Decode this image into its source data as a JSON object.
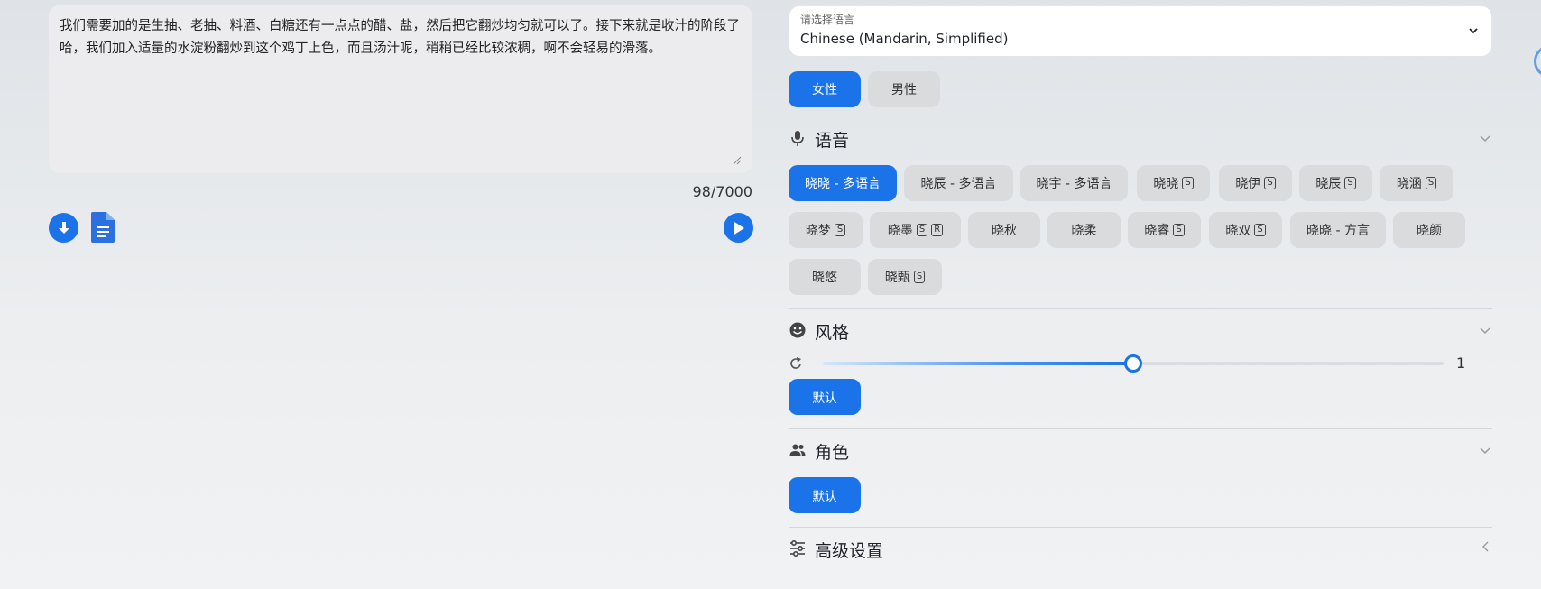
{
  "editor": {
    "text": "我们需要加的是生抽、老抽、料酒、白糖还有一点点的醋、盐，然后把它翻炒均匀就可以了。接下来就是收汁的阶段了哈，我们加入适量的水淀粉翻炒到这个鸡丁上色，而且汤汁呢，稍稍已经比较浓稠，啊不会轻易的滑落。",
    "char_count": "98/7000"
  },
  "language": {
    "label": "请选择语言",
    "value": "Chinese (Mandarin, Simplified)"
  },
  "gender": {
    "female": "女性",
    "male": "男性"
  },
  "voice_section": {
    "title": "语音",
    "voices": [
      {
        "label": "晓晓 - 多语言",
        "tags": [],
        "active": true
      },
      {
        "label": "晓辰 - 多语言",
        "tags": []
      },
      {
        "label": "晓宇 - 多语言",
        "tags": []
      },
      {
        "label": "晓晓",
        "tags": [
          "S"
        ]
      },
      {
        "label": "晓伊",
        "tags": [
          "S"
        ]
      },
      {
        "label": "晓辰",
        "tags": [
          "S"
        ]
      },
      {
        "label": "晓涵",
        "tags": [
          "S"
        ]
      },
      {
        "label": "晓梦",
        "tags": [
          "S"
        ]
      },
      {
        "label": "晓墨",
        "tags": [
          "S",
          "R"
        ]
      },
      {
        "label": "晓秋",
        "tags": []
      },
      {
        "label": "晓柔",
        "tags": []
      },
      {
        "label": "晓睿",
        "tags": [
          "S"
        ]
      },
      {
        "label": "晓双",
        "tags": [
          "S"
        ]
      },
      {
        "label": "晓晓 - 方言",
        "tags": []
      },
      {
        "label": "晓颜",
        "tags": []
      },
      {
        "label": "晓悠",
        "tags": []
      },
      {
        "label": "晓甄",
        "tags": [
          "S"
        ]
      }
    ]
  },
  "style_section": {
    "title": "风格",
    "slider_value": "1",
    "slider_fraction": 0.5,
    "default_button": "默认"
  },
  "role_section": {
    "title": "角色",
    "default_button": "默认"
  },
  "advanced_section": {
    "title": "高级设置"
  },
  "colors": {
    "accent": "#1a73e8"
  }
}
